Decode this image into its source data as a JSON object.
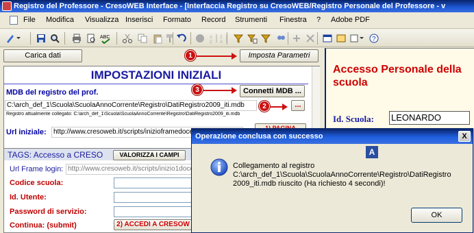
{
  "window": {
    "title": "Registro del Professore - CresoWEB Interface - [Interfaccia Registro su CresoWEB/Registro Personale del Professore - v"
  },
  "menu": [
    "File",
    "Modifica",
    "Visualizza",
    "Inserisci",
    "Formato",
    "Record",
    "Strumenti",
    "Finestra",
    "?",
    "Adobe PDF"
  ],
  "left": {
    "carica_button": "Carica dati",
    "imposta_button": "Imposta Parametri",
    "heading": "IMPOSTAZIONI INIZIALI",
    "mdb_label": "MDB del registro del prof.",
    "connetti_button": "Connetti MDB ...",
    "mdb_path": "C:\\arch_def_1\\Scuola\\ScuolaAnnoCorrente\\Registro\\DatiRegistro2009_iti.mdb",
    "browse_button": "...",
    "connected_text": "Registro attualmente collegato: C:\\arch_def_1\\Scuola\\ScuolaAnnoCorrente\\Registro\\DatiRegistro2009_iti.mdb",
    "url_label": "Url iniziale:",
    "url_value": "http://www.cresoweb.it/scripts/inizioframedocenti",
    "pagina_button": "1) PAGINA",
    "tags_label": "TAGS: Accesso a CRESO",
    "valorizza_button": "VALORIZZA I CAMPI",
    "frame_label": "Url Frame login:",
    "frame_value": "http://www.cresoweb.it/scripts/inizio1docen",
    "codice_label": "Codice scuola:",
    "utente_label": "Id. Utente:",
    "password_label": "Password di servizio:",
    "continua_label": "Continua: (submit)",
    "accedi_button": "2) ACCEDI A CRESOW",
    "badges": [
      "1",
      "2",
      "3"
    ]
  },
  "right": {
    "heading_line1": "Accesso Personale della",
    "heading_line2": "scuola",
    "scuola_label": "Id. Scuola:",
    "scuola_value": "LEONARDO"
  },
  "dialog": {
    "title": "Operazione conclusa con successo",
    "close": "X",
    "badge": "A",
    "line1": "Collegamento al registro",
    "line2": "C:\\arch_def_1\\Scuola\\ScuolaAnnoCorrente\\Registro\\DatiRegistro",
    "line3": "2009_iti.mdb riuscito (Ha richiesto 4 secondi)!",
    "ok": "OK"
  },
  "colors": {
    "accent_red": "#cc1111",
    "title_blue": "#0a246a",
    "heading_blue": "#1a1aa0",
    "right_red": "#cc0000"
  }
}
